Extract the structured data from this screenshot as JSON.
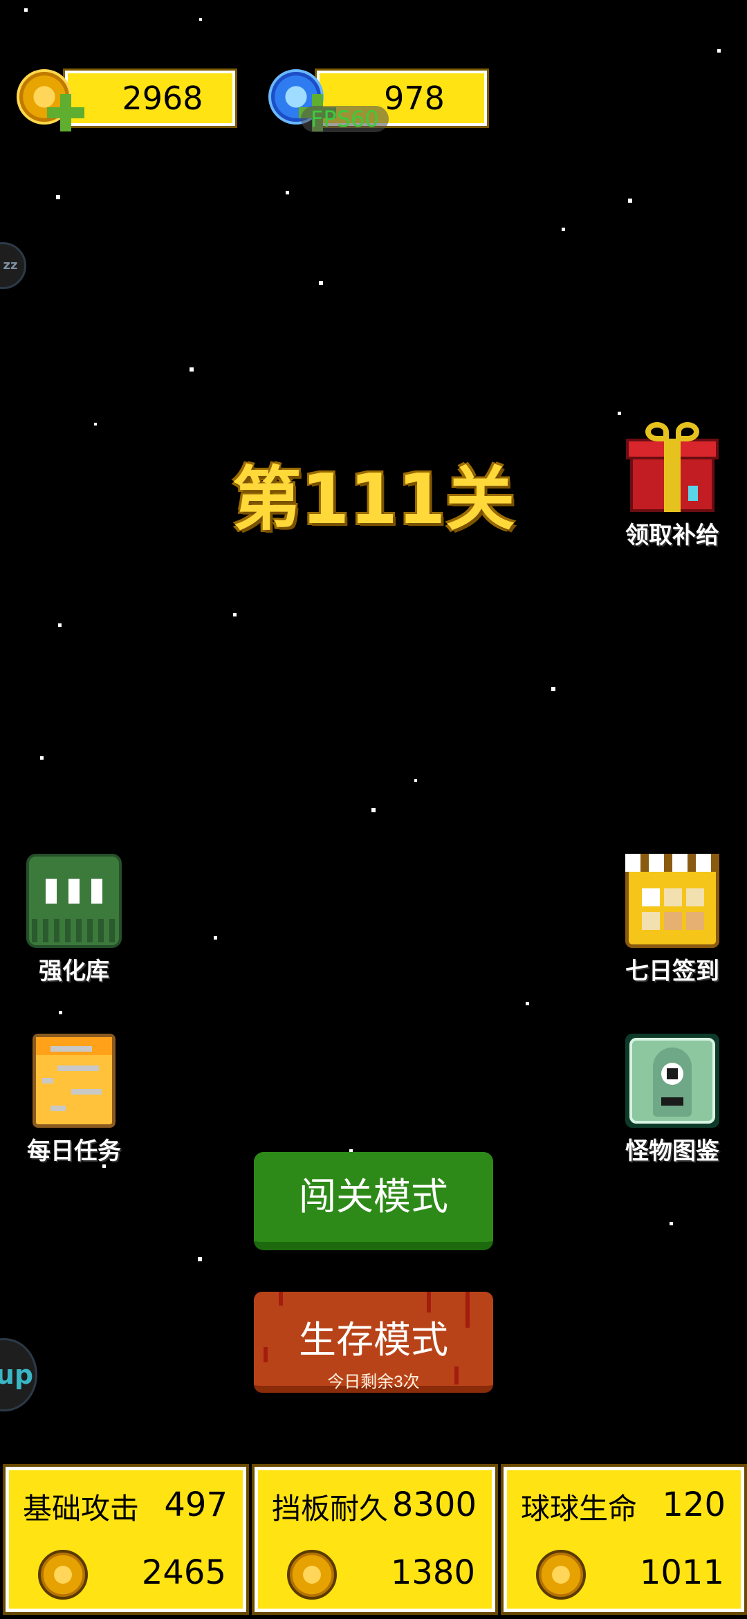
{
  "currencies": {
    "gold": {
      "value": "2968",
      "icon": "gold-coin-icon"
    },
    "gems": {
      "value": "978",
      "icon": "blue-gem-icon"
    }
  },
  "fps": "FPS60",
  "float_left_top": "zz",
  "float_left_bottom": "up",
  "level": {
    "title": "第111关"
  },
  "side": {
    "supply": "领取补给",
    "upgrade": "强化库",
    "checkin": "七日签到",
    "tasks": "每日任务",
    "monsters": "怪物图鉴"
  },
  "modes": {
    "challenge": "闯关模式",
    "survival": "生存模式",
    "survival_sub": "今日剩余3次"
  },
  "stats": [
    {
      "name": "基础攻击",
      "value": "497",
      "cost": "2465"
    },
    {
      "name": "挡板耐久",
      "value": "8300",
      "cost": "1380"
    },
    {
      "name": "球球生命",
      "value": "120",
      "cost": "1011"
    }
  ],
  "colors": {
    "background": "#000000",
    "accent_yellow": "#ffe313",
    "title_gold": "#ffd83a",
    "mode_green": "#2e8a18",
    "mode_orange": "#b94318"
  }
}
